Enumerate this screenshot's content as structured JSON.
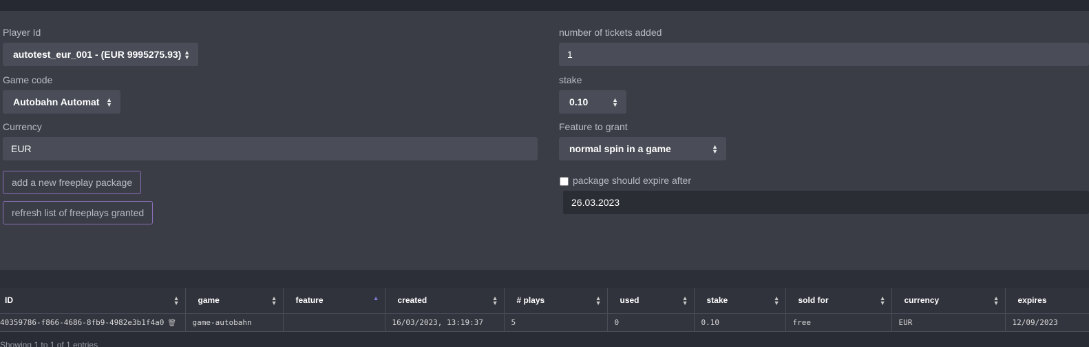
{
  "form": {
    "player_id": {
      "label": "Player Id",
      "value": "autotest_eur_001 - (EUR 9995275.93)"
    },
    "game_code": {
      "label": "Game code",
      "value": "Autobahn Automat"
    },
    "currency": {
      "label": "Currency",
      "value": "EUR"
    },
    "tickets": {
      "label": "number of tickets added",
      "value": "1"
    },
    "stake": {
      "label": "stake",
      "value": "0.10"
    },
    "feature": {
      "label": "Feature to grant",
      "value": "normal spin in a game"
    },
    "expire": {
      "label": "package should expire after",
      "checked": false,
      "date": "26.03.2023"
    },
    "add_button": "add a new freeplay package",
    "refresh_button": "refresh list of freeplays granted"
  },
  "table": {
    "headers": [
      "ID",
      "game",
      "feature",
      "created",
      "# plays",
      "used",
      "stake",
      "sold for",
      "currency",
      "expires"
    ],
    "sorted_column": "feature",
    "rows": [
      [
        "40359786-f866-4686-8fb9-4982e3b1f4a0",
        "game-autobahn",
        "",
        "16/03/2023, 13:19:37",
        "5",
        "0",
        "0.10",
        "free",
        "EUR",
        "12/09/2023"
      ]
    ],
    "info": "Showing 1 to 1 of 1 entries"
  }
}
